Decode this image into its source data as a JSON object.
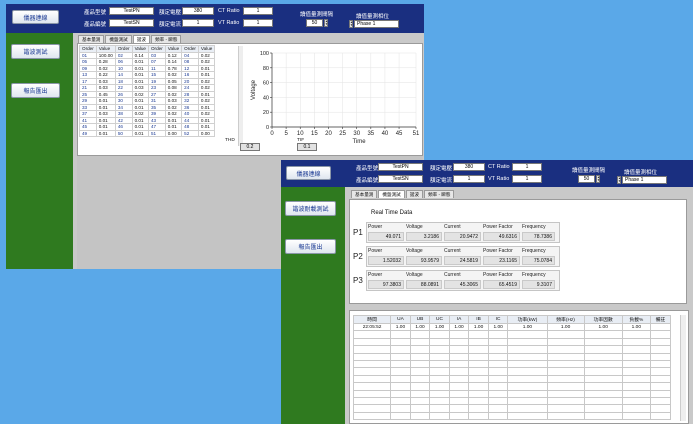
{
  "back_window": {
    "header": {
      "product_model_label": "產品型號",
      "product_model_value": "TestPN",
      "product_serial_label": "產品編號",
      "product_serial_value": "TestSN",
      "rated_voltage_label": "額定電壓",
      "rated_voltage_value": "380",
      "rated_current_label": "額定電流",
      "rated_current_value": "1",
      "ct_label": "CT Ratio",
      "ct_value": "1",
      "vt_label": "VT Ratio",
      "vt_value": "1",
      "interval_label": "讀值量測間隔",
      "interval_value": "50",
      "phase_label": "讀值量測相位",
      "phase_value": "Phase 1"
    },
    "side": {
      "connect": "儀器連線",
      "harmonic_test": "諧波測試",
      "export": "報告匯出"
    },
    "tabs": [
      "基本量測",
      "機盤測試",
      "諧波",
      "頻率 - 瞬態"
    ],
    "active_tab": 2,
    "table_headers": [
      "Order",
      "Value",
      "Order",
      "Value",
      "Order",
      "Value",
      "Order",
      "Value"
    ],
    "table_rows": [
      [
        "01",
        "100.00",
        "02",
        "0.14",
        "03",
        "0.12",
        "04",
        "0.02"
      ],
      [
        "05",
        "0.28",
        "06",
        "0.01",
        "07",
        "0.14",
        "08",
        "0.02"
      ],
      [
        "09",
        "0.02",
        "10",
        "0.01",
        "11",
        "0.78",
        "12",
        "0.01"
      ],
      [
        "13",
        "0.22",
        "14",
        "0.01",
        "15",
        "0.02",
        "16",
        "0.01"
      ],
      [
        "17",
        "0.03",
        "18",
        "0.01",
        "19",
        "0.05",
        "20",
        "0.02"
      ],
      [
        "21",
        "0.03",
        "22",
        "0.03",
        "23",
        "0.08",
        "24",
        "0.02"
      ],
      [
        "25",
        "0.45",
        "26",
        "0.02",
        "27",
        "0.02",
        "28",
        "0.01"
      ],
      [
        "29",
        "0.01",
        "30",
        "0.01",
        "31",
        "0.03",
        "32",
        "0.02"
      ],
      [
        "33",
        "0.01",
        "34",
        "0.01",
        "35",
        "0.02",
        "36",
        "0.01"
      ],
      [
        "37",
        "0.03",
        "38",
        "0.02",
        "39",
        "0.02",
        "40",
        "0.02"
      ],
      [
        "41",
        "0.01",
        "42",
        "0.01",
        "43",
        "0.01",
        "44",
        "0.01"
      ],
      [
        "45",
        "0.01",
        "46",
        "0.01",
        "47",
        "0.01",
        "48",
        "0.01"
      ],
      [
        "49",
        "0.01",
        "50",
        "0.01",
        "51",
        "0.00",
        "52",
        "0.00"
      ]
    ],
    "thd_label": "THD",
    "thd_value": "0.2",
    "tif_label": "TIF",
    "tif_value": "0.1",
    "chart_data": {
      "type": "line",
      "title": "",
      "xlabel": "Time",
      "ylabel": "Voltage",
      "xlim": [
        0,
        51
      ],
      "ylim": [
        0,
        100
      ],
      "x_ticks": [
        0,
        5,
        10,
        15,
        20,
        25,
        30,
        35,
        40,
        45,
        51
      ],
      "y_ticks": [
        0,
        20,
        40,
        60,
        80,
        100
      ],
      "series": [],
      "grid": true
    }
  },
  "front_window": {
    "header": {
      "product_model_label": "產品型號",
      "product_model_value": "TestPN",
      "product_serial_label": "產品編號",
      "product_serial_value": "TestSN",
      "rated_voltage_label": "額定電壓",
      "rated_voltage_value": "380",
      "rated_current_label": "額定電流",
      "rated_current_value": "1",
      "ct_label": "CT Ratio",
      "ct_value": "1",
      "vt_label": "VT Ratio",
      "vt_value": "1",
      "interval_label": "讀值量測間隔",
      "interval_value": "50",
      "phase_label": "讀值量測相位",
      "phase_value": "Phase 1"
    },
    "side": {
      "connect": "儀器連線",
      "ripple_test": "諧波耐載測試",
      "export": "報告匯出"
    },
    "tabs": [
      "基本量測",
      "機盤測試",
      "諧波",
      "頻率 - 瞬態"
    ],
    "active_tab": 1,
    "realtime_title": "Real Time Data",
    "phases": [
      {
        "name": "P1",
        "labels": [
          "Power",
          "Voltage",
          "Current",
          "Power Factor",
          "Frequency"
        ],
        "values": [
          "49.071",
          "3.2186",
          "20.9472",
          "49.6316",
          "78.7386"
        ]
      },
      {
        "name": "P2",
        "labels": [
          "Power",
          "Voltage",
          "Current",
          "Power Factor",
          "Frequency"
        ],
        "values": [
          "1.52032",
          "93.9579",
          "24.5819",
          "23.1165",
          "75.0784"
        ]
      },
      {
        "name": "P3",
        "labels": [
          "Power",
          "Voltage",
          "Current",
          "Power Factor",
          "Frequency"
        ],
        "values": [
          "97.3803",
          "88.0891",
          "45.3065",
          "65.4519",
          "9.3107"
        ]
      }
    ],
    "log_headers": [
      "時間",
      "UA",
      "UB",
      "UC",
      "IA",
      "IB",
      "IC",
      "功率(kW)",
      "頻率(Hz)",
      "功率因數",
      "負載%",
      "備註"
    ],
    "log_rows": [
      [
        "22:05:52",
        "1.00",
        "1.00",
        "1.00",
        "1.00",
        "1.00",
        "1.00",
        "1.00",
        "1.00",
        "1.00",
        "1.00",
        ""
      ]
    ]
  }
}
